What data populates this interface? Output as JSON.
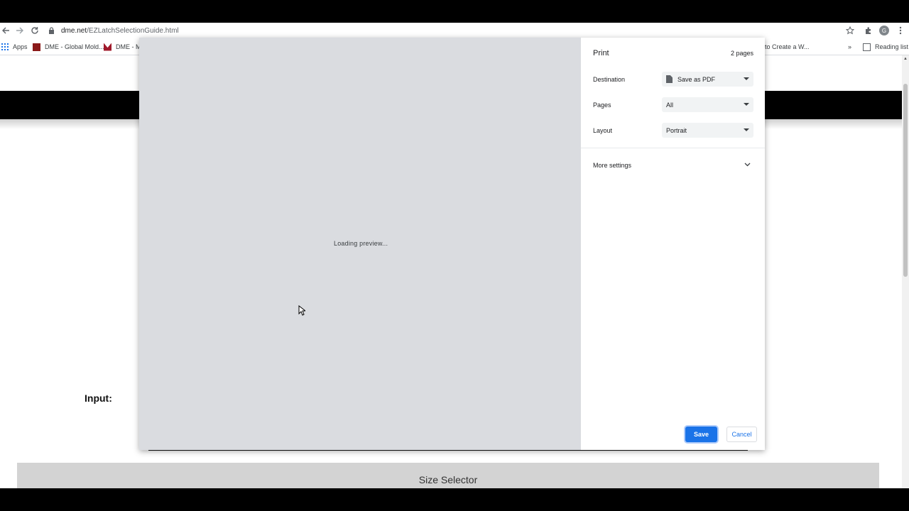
{
  "browser": {
    "url_host": "dme.net",
    "url_path": "/EZLatchSelectionGuide.html",
    "profile_initial": "G",
    "bookmarks": {
      "apps": "Apps",
      "items": [
        "DME - Global Mold...",
        "DME - M",
        "to Create a W..."
      ],
      "overflow": "»",
      "reading_list": "Reading list"
    },
    "icons": {
      "back": "back-arrow-icon",
      "forward": "forward-arrow-icon",
      "reload": "reload-icon",
      "lock": "lock-icon",
      "star": "star-icon",
      "extensions": "puzzle-icon",
      "menu": "kebab-menu-icon"
    }
  },
  "page": {
    "input_label": "Input:",
    "size_selector": "Size Selector"
  },
  "print_dialog": {
    "title": "Print",
    "page_count": "2 pages",
    "preview_status": "Loading preview...",
    "destination": {
      "label": "Destination",
      "value": "Save as PDF"
    },
    "pages": {
      "label": "Pages",
      "value": "All"
    },
    "layout": {
      "label": "Layout",
      "value": "Portrait"
    },
    "more_settings": "More settings",
    "save_button": "Save",
    "cancel_button": "Cancel"
  },
  "colors": {
    "accent": "#1a73e8",
    "preview_bg": "#dadce0",
    "select_bg": "#f1f3f4",
    "band": "#000000",
    "size_selector_bg": "#d3d3d3"
  }
}
